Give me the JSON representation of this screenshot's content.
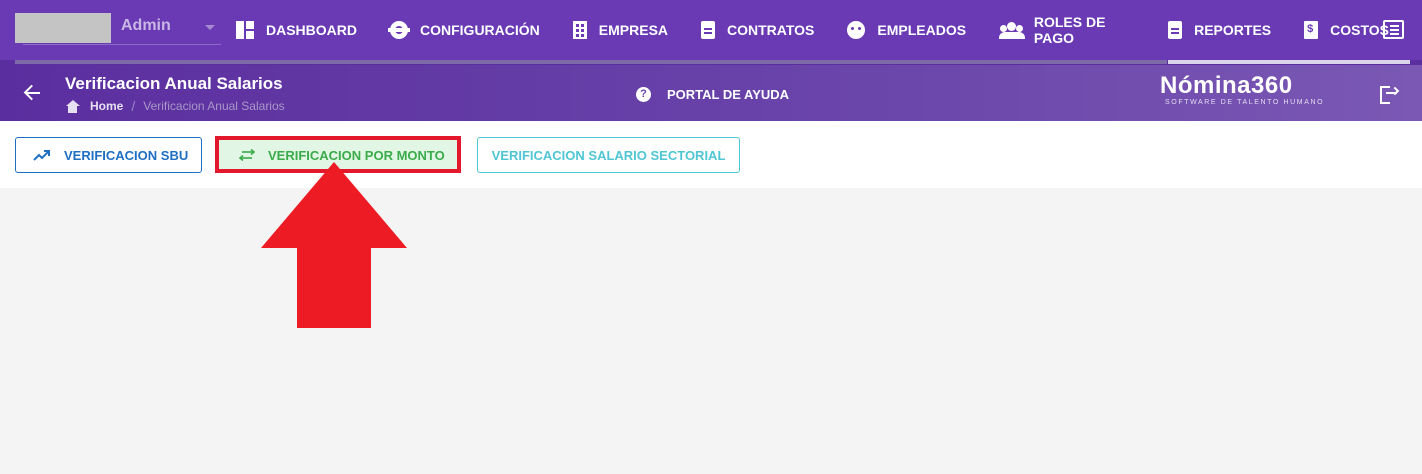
{
  "user": {
    "name": "Admin"
  },
  "nav": {
    "items": [
      {
        "label": "DASHBOARD",
        "icon": "dashboard-icon"
      },
      {
        "label": "CONFIGURACIÓN",
        "icon": "gear-icon"
      },
      {
        "label": "EMPRESA",
        "icon": "building-icon"
      },
      {
        "label": "CONTRATOS",
        "icon": "clipboard-icon"
      },
      {
        "label": "EMPLEADOS",
        "icon": "face-icon"
      },
      {
        "label": "ROLES DE PAGO",
        "icon": "users-icon"
      },
      {
        "label": "REPORTES",
        "icon": "clipboard-icon"
      },
      {
        "label": "COSTOS",
        "icon": "file-dollar-icon"
      }
    ]
  },
  "header": {
    "title": "Verificacion Anual Salarios",
    "breadcrumb": {
      "home": "Home",
      "separator": "/",
      "current": "Verificacion Anual Salarios"
    },
    "help_label": "PORTAL DE AYUDA",
    "logo_main": "Nómina360",
    "logo_sub": "SOFTWARE DE TALENTO HUMANO"
  },
  "toolbar": {
    "sbu_label": "VERIFICACION SBU",
    "monto_label": "VERIFICACION POR MONTO",
    "sectorial_label": "VERIFICACION SALARIO SECTORIAL"
  },
  "colors": {
    "nav_bg": "#6a3ab5",
    "sbu": "#1e6fc4",
    "monto": "#3bab4b",
    "monto_bg": "#e1f6e4",
    "sectorial": "#4fc6d3",
    "annotation": "#e3182c"
  }
}
